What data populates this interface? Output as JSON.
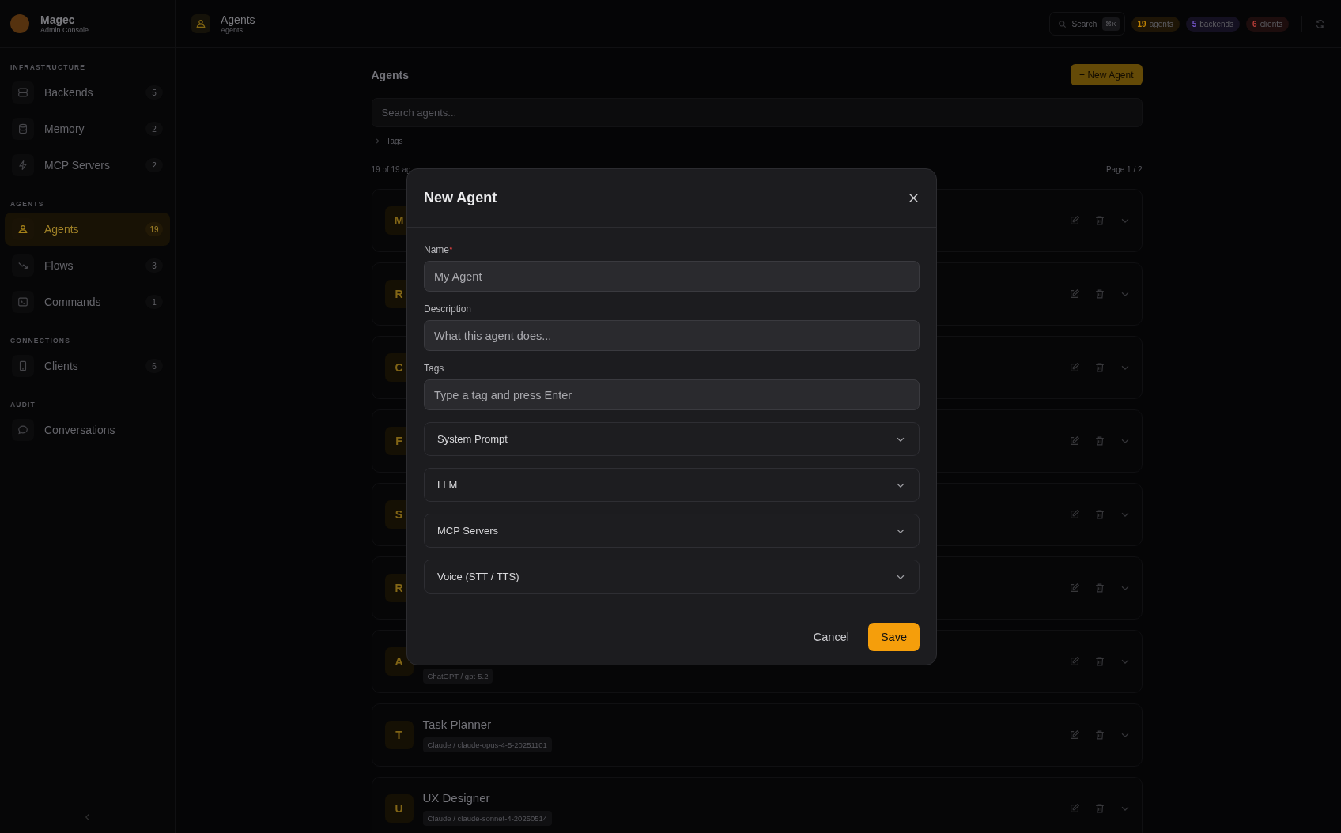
{
  "app": {
    "name": "Magec",
    "subtitle": "Admin Console"
  },
  "sidebar": {
    "sections": [
      {
        "title": "INFRASTRUCTURE",
        "items": [
          {
            "kind": "server",
            "label": "Backends",
            "count": "5",
            "selected": false
          },
          {
            "kind": "database",
            "label": "Memory",
            "count": "2",
            "selected": false
          },
          {
            "kind": "bolt",
            "label": "MCP Servers",
            "count": "2",
            "selected": false
          }
        ]
      },
      {
        "title": "AGENTS",
        "items": [
          {
            "kind": "person",
            "label": "Agents",
            "count": "19",
            "selected": true
          },
          {
            "kind": "trend",
            "label": "Flows",
            "count": "3",
            "selected": false
          },
          {
            "kind": "terminal",
            "label": "Commands",
            "count": "1",
            "selected": false
          }
        ]
      },
      {
        "title": "CONNECTIONS",
        "items": [
          {
            "kind": "phone",
            "label": "Clients",
            "count": "6",
            "selected": false
          }
        ]
      },
      {
        "title": "AUDIT",
        "items": [
          {
            "kind": "chat",
            "label": "Conversations",
            "selected": false
          }
        ]
      }
    ]
  },
  "topbar": {
    "title": "Agents",
    "subtitle": "Agents",
    "search": {
      "label": "Search",
      "shortcut": "⌘K"
    },
    "stats": [
      {
        "value": "19",
        "label": "agents",
        "color": "#ca8a04"
      },
      {
        "value": "5",
        "label": "backends",
        "color": "#7c5cd6"
      },
      {
        "value": "6",
        "label": "clients",
        "color": "#c2413c"
      }
    ]
  },
  "page": {
    "title": "Agents",
    "new_button": "+ New Agent",
    "search": {
      "placeholder": "Search agents..."
    },
    "tags_toggle": {
      "label": "Tags",
      "expanded": false
    },
    "count": "19 of 19 ag",
    "pagination": "Page 1 / 2",
    "agents": [
      {
        "initial": "M"
      },
      {
        "initial": "R"
      },
      {
        "initial": "C"
      },
      {
        "initial": "F"
      },
      {
        "initial": "S"
      },
      {
        "initial": "R"
      },
      {
        "initial": "A",
        "model": "ChatGPT / gpt-5.2"
      },
      {
        "initial": "T",
        "name": "Task Planner",
        "model": "Claude / claude-opus-4-5-20251101"
      },
      {
        "initial": "U",
        "name": "UX Designer",
        "model": "Claude / claude-sonnet-4-20250514"
      }
    ]
  },
  "modal": {
    "title": "New Agent",
    "fields": [
      {
        "label": "Name",
        "required_mark": "*",
        "placeholder": "My Agent"
      },
      {
        "label": "Description",
        "placeholder": "What this agent does..."
      },
      {
        "label": "Tags",
        "placeholder": "Type a tag and press Enter"
      }
    ],
    "sections": [
      {
        "label": "System Prompt",
        "expanded": false
      },
      {
        "label": "LLM",
        "expanded": false
      },
      {
        "label": "MCP Servers",
        "expanded": false
      },
      {
        "label": "Voice (STT / TTS)",
        "expanded": false
      }
    ],
    "cancel": "Cancel",
    "save": "Save"
  }
}
